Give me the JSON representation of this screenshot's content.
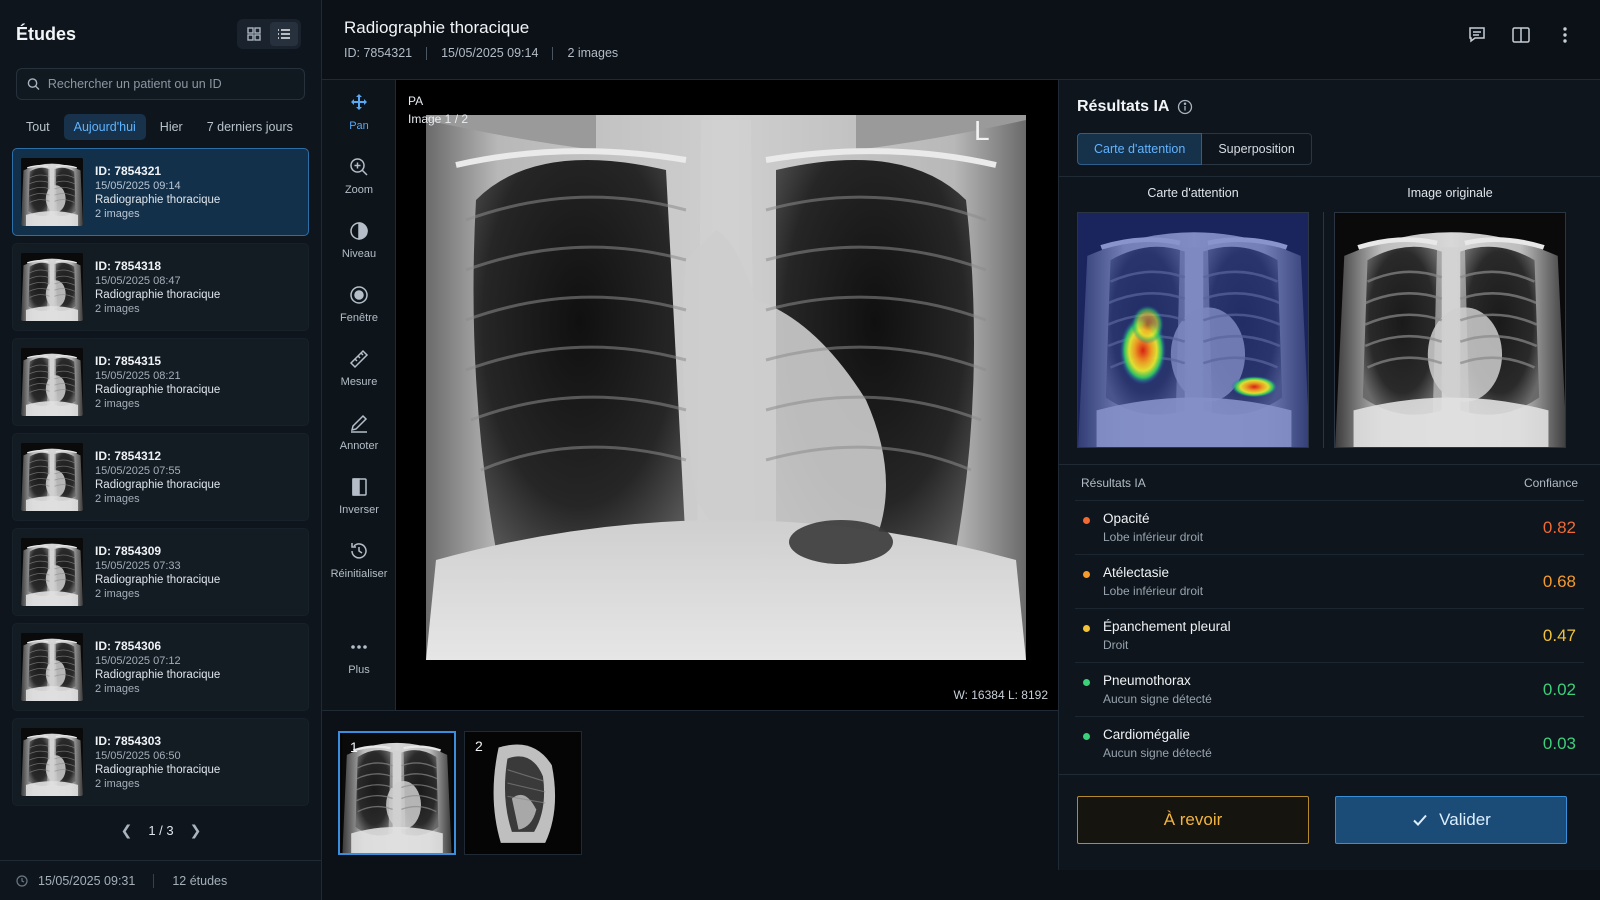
{
  "sidebar": {
    "title": "Études",
    "search": {
      "placeholder": "Rechercher un patient ou un ID",
      "value": ""
    },
    "filters": [
      "Tout",
      "Aujourd'hui",
      "Hier",
      "7 derniers jours"
    ],
    "active_filter": "Aujourd'hui",
    "studies": [
      {
        "id": "ID: 7854321",
        "datetime": "15/05/2025 09:14",
        "type": "Radiographie thoracique",
        "images": "2 images",
        "active": true
      },
      {
        "id": "ID: 7854318",
        "datetime": "15/05/2025 08:47",
        "type": "Radiographie thoracique",
        "images": "2 images",
        "active": false
      },
      {
        "id": "ID: 7854315",
        "datetime": "15/05/2025 08:21",
        "type": "Radiographie thoracique",
        "images": "2 images",
        "active": false
      },
      {
        "id": "ID: 7854312",
        "datetime": "15/05/2025 07:55",
        "type": "Radiographie thoracique",
        "images": "2 images",
        "active": false
      },
      {
        "id": "ID: 7854309",
        "datetime": "15/05/2025 07:33",
        "type": "Radiographie thoracique",
        "images": "2 images",
        "active": false
      },
      {
        "id": "ID: 7854306",
        "datetime": "15/05/2025 07:12",
        "type": "Radiographie thoracique",
        "images": "2 images",
        "active": false
      },
      {
        "id": "ID: 7854303",
        "datetime": "15/05/2025 06:50",
        "type": "Radiographie thoracique",
        "images": "2 images",
        "active": false
      }
    ],
    "pager": "1 / 3",
    "footer": {
      "datetime": "15/05/2025 09:31",
      "count": "12 études"
    }
  },
  "header": {
    "title": "Radiographie thoracique",
    "id": "ID: 7854321",
    "datetime": "15/05/2025 09:14",
    "images": "2 images"
  },
  "tools": [
    {
      "label": "Pan",
      "icon": "pan-icon",
      "active": true
    },
    {
      "label": "Zoom",
      "icon": "zoom-icon",
      "active": false
    },
    {
      "label": "Niveau",
      "icon": "level-icon",
      "active": false
    },
    {
      "label": "Fenêtre",
      "icon": "window-icon",
      "active": false
    },
    {
      "label": "Mesure",
      "icon": "ruler-icon",
      "active": false
    },
    {
      "label": "Annoter",
      "icon": "pencil-icon",
      "active": false
    },
    {
      "label": "Inverser",
      "icon": "invert-icon",
      "active": false
    },
    {
      "label": "Réinitialiser",
      "icon": "reset-icon",
      "active": false
    },
    {
      "label": "Plus",
      "icon": "more-icon",
      "active": false
    }
  ],
  "viewer": {
    "view": "PA",
    "image_index": "Image 1 / 2",
    "marker": "L",
    "wl": "W: 16384    L: 8192"
  },
  "thumbnails": [
    {
      "num": "1",
      "view": "frontal",
      "active": true
    },
    {
      "num": "2",
      "view": "lateral",
      "active": false
    }
  ],
  "ai": {
    "title": "Résultats IA",
    "tabs": [
      "Carte d'attention",
      "Superposition"
    ],
    "active_tab": "Carte d'attention",
    "compare_labels": [
      "Carte d'attention",
      "Image originale"
    ],
    "results_header": "Résultats IA",
    "confidence_header": "Confiance",
    "results": [
      {
        "name": "Opacité",
        "location": "Lobe inférieur droit",
        "confidence": "0.82",
        "color": "#f06a35"
      },
      {
        "name": "Atélectasie",
        "location": "Lobe inférieur droit",
        "confidence": "0.68",
        "color": "#f59a2e"
      },
      {
        "name": "Épanchement pleural",
        "location": "Droit",
        "confidence": "0.47",
        "color": "#f2c23a"
      },
      {
        "name": "Pneumothorax",
        "location": "Aucun signe détecté",
        "confidence": "0.02",
        "color": "#3ecf7a"
      },
      {
        "name": "Cardiomégalie",
        "location": "Aucun signe détecté",
        "confidence": "0.03",
        "color": "#3ecf7a"
      }
    ],
    "review_label": "À revoir",
    "validate_label": "Valider"
  },
  "colors": {
    "accent": "#3b8ede",
    "warning": "#f2b440",
    "danger": "#f06a35",
    "ok": "#3ecf7a"
  }
}
